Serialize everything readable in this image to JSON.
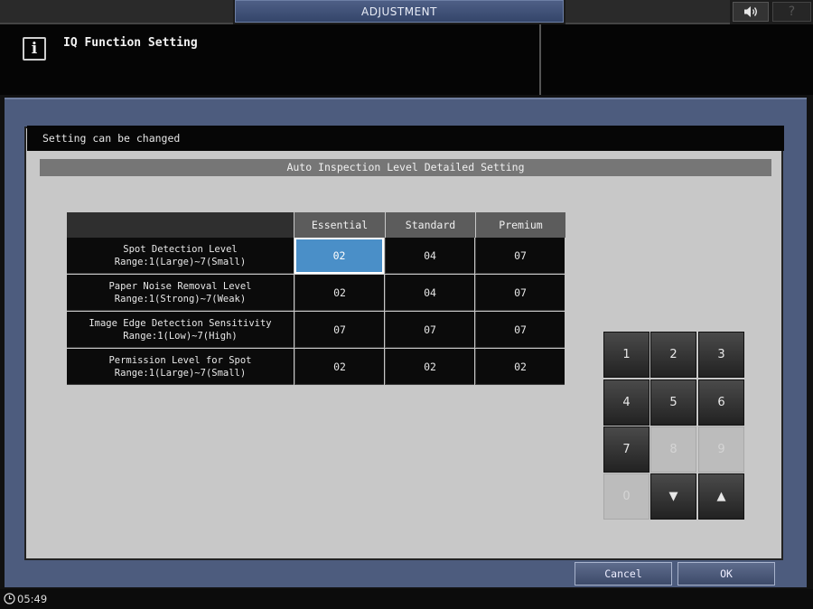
{
  "top_bar": {
    "title": "ADJUSTMENT",
    "help_label": "?"
  },
  "header": {
    "info_icon_glyph": "i",
    "title": "IQ Function Setting"
  },
  "message": "Setting can be changed",
  "section_title": "Auto Inspection Level Detailed Setting",
  "table": {
    "columns": [
      "Essential",
      "Standard",
      "Premium"
    ],
    "rows": [
      {
        "label": "Spot Detection Level",
        "range": "Range:1(Large)~7(Small)",
        "values": [
          "02",
          "04",
          "07"
        ]
      },
      {
        "label": "Paper Noise Removal Level",
        "range": "Range:1(Strong)~7(Weak)",
        "values": [
          "02",
          "04",
          "07"
        ]
      },
      {
        "label": "Image Edge Detection Sensitivity",
        "range": "Range:1(Low)~7(High)",
        "values": [
          "07",
          "07",
          "07"
        ]
      },
      {
        "label": "Permission Level for Spot",
        "range": "Range:1(Large)~7(Small)",
        "values": [
          "02",
          "02",
          "02"
        ]
      }
    ],
    "selected_cell": "row 1, Essential"
  },
  "keypad": {
    "keys": [
      "1",
      "2",
      "3",
      "4",
      "5",
      "6",
      "7",
      "8",
      "9",
      "0",
      "▼",
      "▲"
    ],
    "disabled": [
      "8",
      "9",
      "0"
    ]
  },
  "buttons": {
    "cancel": "Cancel",
    "ok": "OK"
  },
  "status": {
    "time": "05:49"
  },
  "colors": {
    "frame": "#4d5c7e",
    "selected_cell": "#4a8fc8",
    "title_bar": "#3f5078"
  }
}
